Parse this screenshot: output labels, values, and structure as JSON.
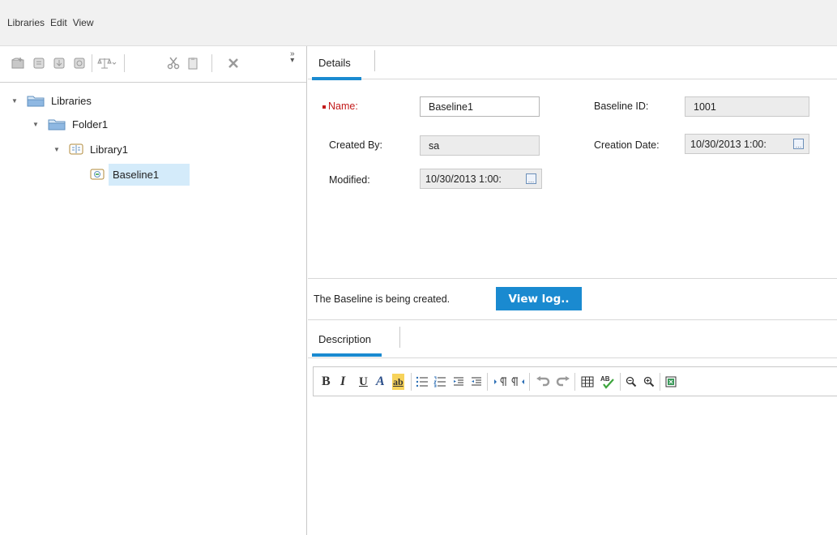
{
  "menubar": {
    "items": [
      "Libraries",
      "Edit",
      "View"
    ]
  },
  "left_toolbar": {
    "buttons": [
      {
        "icon": "new-library-icon"
      },
      {
        "icon": "library-icon"
      },
      {
        "icon": "import-library-icon"
      },
      {
        "icon": "baseline-icon"
      },
      {
        "icon": "compare-icon"
      },
      {
        "icon": "cut-icon"
      },
      {
        "icon": "paste-icon"
      },
      {
        "icon": "delete-icon"
      }
    ],
    "overflow": "»"
  },
  "tree": {
    "items": [
      {
        "label": "Libraries",
        "icon": "folder-icon",
        "expanded": true
      },
      {
        "label": "Folder1",
        "icon": "folder-icon",
        "expanded": true
      },
      {
        "label": "Library1",
        "icon": "library-icon",
        "expanded": true
      },
      {
        "label": "Baseline1",
        "icon": "baseline-icon",
        "selected": true
      }
    ]
  },
  "details": {
    "tab": "Details",
    "fields": {
      "name": {
        "label": "Name:",
        "value": "Baseline1"
      },
      "baseline_id": {
        "label": "Baseline ID:",
        "value": "1001"
      },
      "created_by": {
        "label": "Created By:",
        "value": "sa"
      },
      "creation_date": {
        "label": "Creation Date:",
        "value": "10/30/2013 1:00:"
      },
      "modified": {
        "label": "Modified:",
        "value": "10/30/2013 1:00:"
      }
    }
  },
  "status": {
    "text": "The Baseline is being created.",
    "button": "View log.."
  },
  "description": {
    "tab": "Description"
  },
  "editor_toolbar": {
    "bold": "B",
    "italic": "I",
    "underline": "U",
    "font_color": "A",
    "highlight": "ab"
  },
  "colors": {
    "accent": "#1a8ad0",
    "required": "#c21a1a",
    "selection": "#d4ebfa"
  }
}
